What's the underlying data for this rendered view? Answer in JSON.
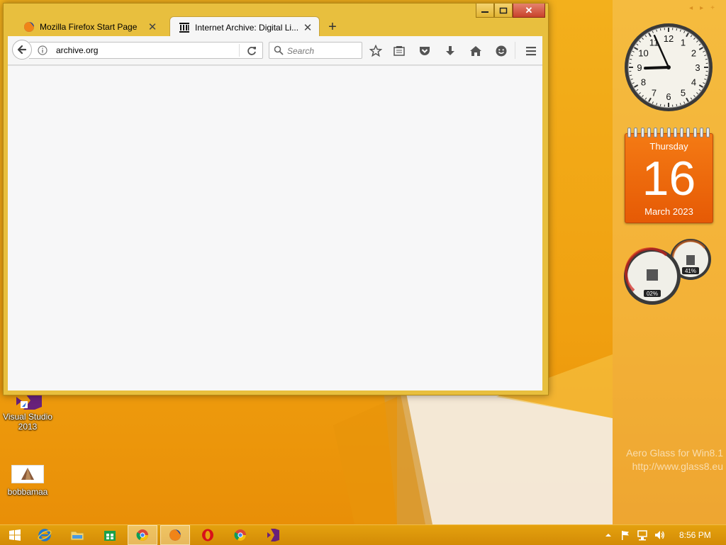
{
  "browser": {
    "tabs": [
      {
        "title": "Mozilla Firefox Start Page",
        "active": false,
        "favicon": "firefox-icon"
      },
      {
        "title": "Internet Archive: Digital Li...",
        "active": true,
        "favicon": "archive-icon"
      }
    ],
    "new_tab_label": "+",
    "tab_close_label": "✕",
    "url": "archive.org",
    "search_placeholder": "Search",
    "toolbar_icons": [
      "bookmark-star-icon",
      "reading-list-icon",
      "pocket-icon",
      "download-icon",
      "home-icon",
      "hello-icon",
      "menu-icon"
    ],
    "caption": {
      "minimize": "–",
      "maximize": "□",
      "close": "✕"
    }
  },
  "desktop": {
    "icons": [
      {
        "label": "Visual Studio\n2013",
        "line1": "Visual Studio",
        "line2": "2013"
      },
      {
        "label": "bobbamaa"
      }
    ]
  },
  "gadgets": {
    "clock": {
      "hour": 8,
      "minute": 56,
      "numbers": [
        "12",
        "1",
        "2",
        "3",
        "4",
        "5",
        "6",
        "7",
        "8",
        "9",
        "10",
        "11"
      ]
    },
    "calendar": {
      "weekday": "Thursday",
      "day": "16",
      "month_year": "March 2023"
    },
    "meter": {
      "cpu": "02%",
      "memory": "41%",
      "cpu_fraction": 0.02,
      "memory_fraction": 0.41
    },
    "aero_line1": "Aero Glass for Win8.1",
    "aero_line2": "http://www.glass8.eu"
  },
  "taskbar": {
    "time": "8:56 PM",
    "apps": [
      "windows-start-icon",
      "internet-explorer-icon",
      "file-explorer-icon",
      "store-icon",
      "chrome-icon",
      "firefox-icon",
      "opera-icon",
      "chrome-icon",
      "visual-studio-icon"
    ]
  },
  "colors": {
    "accent": "#f0a818",
    "calendar": "#e65a05",
    "window_frame": "#e8bf3e"
  }
}
